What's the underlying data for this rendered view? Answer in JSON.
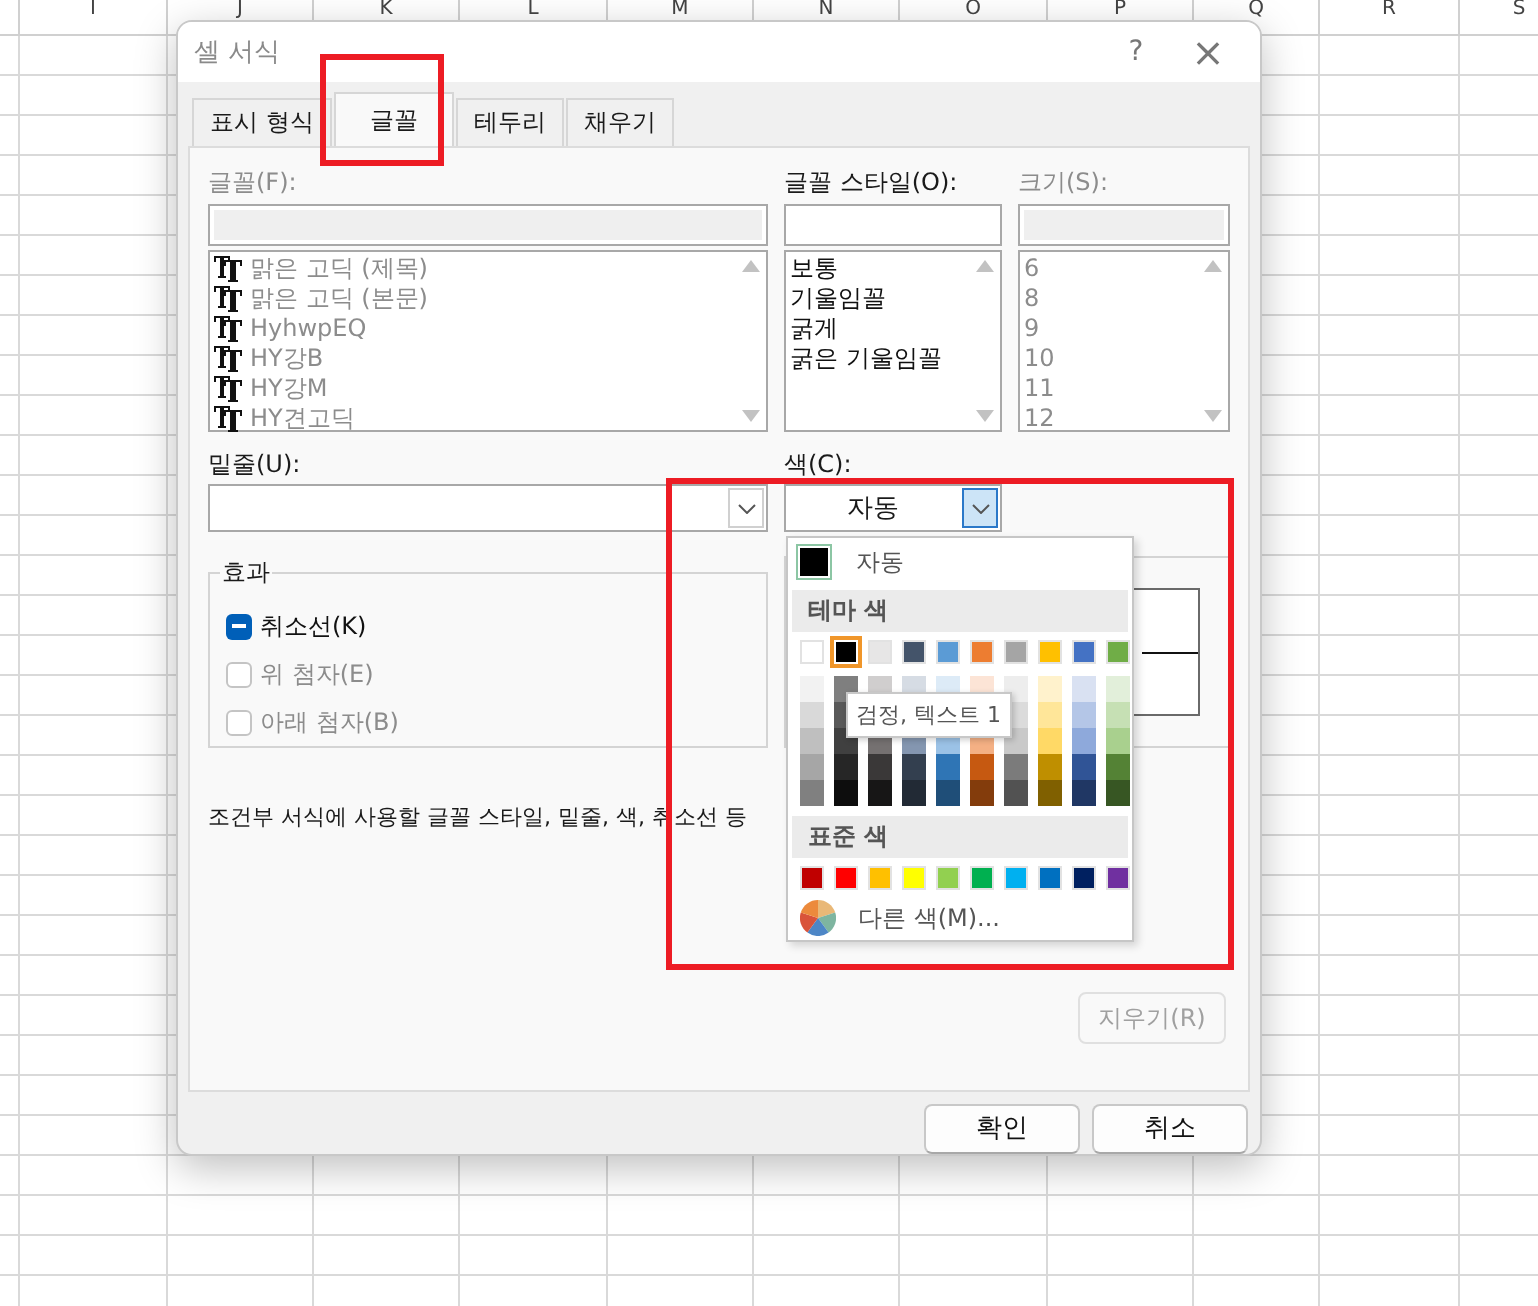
{
  "sheet": {
    "columns": [
      "I",
      "J",
      "K",
      "L",
      "M",
      "N",
      "O",
      "P",
      "Q",
      "R",
      "S"
    ]
  },
  "dialog": {
    "title": "셀 서식",
    "help": "?",
    "close": "×",
    "tabs": [
      {
        "label": "표시 형식",
        "selected": false
      },
      {
        "label": "글꼴",
        "selected": true
      },
      {
        "label": "테두리",
        "selected": false
      },
      {
        "label": "채우기",
        "selected": false
      }
    ],
    "font": {
      "label": "글꼴(F):",
      "disabled": true,
      "items": [
        "맑은 고딕 (제목)",
        "맑은 고딕 (본문)",
        "HyhwpEQ",
        "HY강B",
        "HY강M",
        "HY견고딕"
      ]
    },
    "style": {
      "label": "글꼴 스타일(O):",
      "disabled": false,
      "items": [
        "보통",
        "기울임꼴",
        "굵게",
        "굵은 기울임꼴"
      ]
    },
    "size": {
      "label": "크기(S):",
      "disabled": true,
      "items": [
        "6",
        "8",
        "9",
        "10",
        "11",
        "12"
      ]
    },
    "underline": {
      "label": "밑줄(U):"
    },
    "color": {
      "label": "색(C):",
      "value": "자동",
      "open": true
    },
    "effects": {
      "title": "효과",
      "items": [
        {
          "label": "취소선(K)",
          "indeterminate": true,
          "disabled": false
        },
        {
          "label": "위 첨자(E)",
          "indeterminate": false,
          "disabled": true
        },
        {
          "label": "아래 첨자(B)",
          "indeterminate": false,
          "disabled": true
        }
      ]
    },
    "description": "조건부 서식에 사용할 글꼴 스타일, 밑줄, 색, 취소선 등",
    "clear_button": {
      "label": "지우기(R)",
      "disabled": true
    },
    "buttons": [
      "확인",
      "취소"
    ]
  },
  "color_menu": {
    "automatic": {
      "label": "자동",
      "color": "#000000"
    },
    "theme_title": "테마 색",
    "theme": [
      {
        "color": "#ffffff",
        "selected": false,
        "shades": [
          {
            "color": "#f2f2f2"
          },
          {
            "color": "#d9d9d9"
          },
          {
            "color": "#bfbfbf"
          },
          {
            "color": "#a6a6a6"
          },
          {
            "color": "#808080"
          }
        ]
      },
      {
        "color": "#000000",
        "selected": true,
        "shades": [
          {
            "color": "#7f7f7f"
          },
          {
            "color": "#595959"
          },
          {
            "color": "#404040"
          },
          {
            "color": "#262626"
          },
          {
            "color": "#0d0d0d"
          }
        ]
      },
      {
        "color": "#e7e6e6",
        "selected": false,
        "shades": [
          {
            "color": "#d0cece"
          },
          {
            "hidden": true
          },
          {
            "color": "#757171"
          },
          {
            "color": "#3a3838"
          },
          {
            "color": "#171616"
          }
        ]
      },
      {
        "color": "#44546a",
        "selected": false,
        "shades": [
          {
            "color": "#d6dce4"
          },
          {
            "hidden": true
          },
          {
            "color": "#8496b0"
          },
          {
            "color": "#333f4f"
          },
          {
            "color": "#222a35"
          }
        ]
      },
      {
        "color": "#5b9bd5",
        "selected": false,
        "shades": [
          {
            "color": "#ddebf7"
          },
          {
            "hidden": true
          },
          {
            "color": "#9bc2e6"
          },
          {
            "color": "#2f75b5"
          },
          {
            "color": "#1f4e78"
          }
        ]
      },
      {
        "color": "#ed7d31",
        "selected": false,
        "shades": [
          {
            "color": "#fce4d6"
          },
          {
            "hidden": true
          },
          {
            "color": "#f4b084"
          },
          {
            "color": "#c65911"
          },
          {
            "color": "#833c0c"
          }
        ]
      },
      {
        "color": "#a5a5a5",
        "selected": false,
        "shades": [
          {
            "color": "#ededed"
          },
          {
            "color": "#dbdbdb"
          },
          {
            "color": "#c9c9c9"
          },
          {
            "color": "#7b7b7b"
          },
          {
            "color": "#525252"
          }
        ]
      },
      {
        "color": "#ffc000",
        "selected": false,
        "shades": [
          {
            "color": "#fff2cc"
          },
          {
            "color": "#ffe699"
          },
          {
            "color": "#ffd966"
          },
          {
            "color": "#bf8f00"
          },
          {
            "color": "#806000"
          }
        ]
      },
      {
        "color": "#4472c4",
        "selected": false,
        "shades": [
          {
            "color": "#d9e1f2"
          },
          {
            "color": "#b4c6e7"
          },
          {
            "color": "#8ea9db"
          },
          {
            "color": "#305496"
          },
          {
            "color": "#203764"
          }
        ]
      },
      {
        "color": "#70ad47",
        "selected": false,
        "shades": [
          {
            "color": "#e2efda"
          },
          {
            "color": "#c6e0b4"
          },
          {
            "color": "#a9d08e"
          },
          {
            "color": "#548235"
          },
          {
            "color": "#375623"
          }
        ]
      }
    ],
    "standard_title": "표준 색",
    "standard": [
      {
        "color": "#c00000"
      },
      {
        "color": "#ff0000"
      },
      {
        "color": "#ffc000"
      },
      {
        "color": "#ffff00"
      },
      {
        "color": "#92d050"
      },
      {
        "color": "#00b050"
      },
      {
        "color": "#00b0f0"
      },
      {
        "color": "#0070c0"
      },
      {
        "color": "#002060"
      },
      {
        "color": "#7030a0"
      }
    ],
    "more": "다른 색(M)...",
    "tooltip": "검정, 텍스트 1"
  }
}
